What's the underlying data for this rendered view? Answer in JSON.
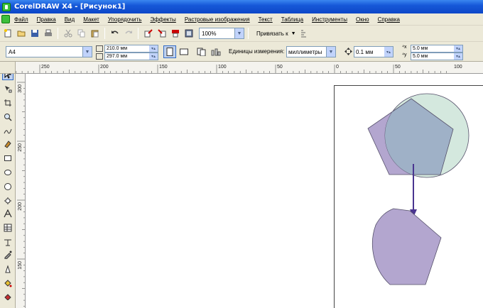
{
  "window": {
    "title": "CorelDRAW X4 - [Рисунок1]"
  },
  "menu": [
    "Файл",
    "Правка",
    "Вид",
    "Макет",
    "Упорядочить",
    "Эффекты",
    "Растровые изображения",
    "Текст",
    "Таблица",
    "Инструменты",
    "Окно",
    "Справка"
  ],
  "toolbar": {
    "zoom_value": "100%",
    "snap_label": "Привязать к",
    "icons": [
      "new-icon",
      "open-icon",
      "save-icon",
      "print-icon",
      "cut-icon",
      "copy-icon",
      "paste-icon",
      "undo-icon",
      "redo-icon",
      "import-icon",
      "export-icon",
      "publish-icon",
      "app-launcher-icon"
    ]
  },
  "property_bar": {
    "page_size": "A4",
    "width": "210.0 мм",
    "height": "297.0 мм",
    "units_label": "Единицы измерения:",
    "units_value": "миллиметры",
    "nudge_value": "0.1 мм",
    "dup_x": "5.0 мм",
    "dup_y": "5.0 мм"
  },
  "rulers": {
    "horizontal_labels": [
      "250",
      "200",
      "150",
      "100",
      "50",
      "0",
      "50",
      "100"
    ],
    "vertical_labels": [
      "300",
      "250",
      "200",
      "150"
    ]
  },
  "toolbox": [
    "pick-tool-icon",
    "shape-tool-icon",
    "crop-tool-icon",
    "zoom-tool-icon",
    "freehand-tool-icon",
    "smart-fill-tool-icon",
    "rectangle-tool-icon",
    "ellipse-tool-icon",
    "polygon-tool-icon",
    "basic-shapes-tool-icon",
    "text-tool-icon",
    "table-tool-icon",
    "dimension-tool-icon",
    "eyedropper-tool-icon",
    "outline-tool-icon",
    "fill-tool-icon",
    "interactive-fill-tool-icon"
  ],
  "colors": {
    "pentagon_fill": "#b3a6cf",
    "circle_fill": "#cfe6da",
    "overlap_fill": "#9fb1c7",
    "shape_stroke": "#55506a",
    "arrow_color": "#4a3590"
  }
}
